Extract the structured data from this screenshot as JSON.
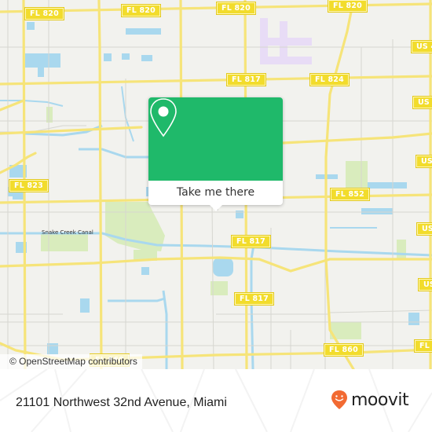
{
  "map": {
    "colors": {
      "background": "#f2f2ee",
      "road_major": "#f6e479",
      "road_minor": "#d6d6d0",
      "water": "#a9d8ee",
      "park": "#d9ecbd",
      "shield_fill": "#f2dc2c"
    },
    "road_shields": [
      {
        "id": "fl820-a",
        "label": "FL 820"
      },
      {
        "id": "fl820-b",
        "label": "FL 820"
      },
      {
        "id": "fl820-c",
        "label": "FL 820"
      },
      {
        "id": "fl820-d",
        "label": "FL 820"
      },
      {
        "id": "fl817-a",
        "label": "FL 817"
      },
      {
        "id": "fl824",
        "label": "FL 824"
      },
      {
        "id": "fl823",
        "label": "FL 823"
      },
      {
        "id": "fl852",
        "label": "FL 852"
      },
      {
        "id": "fl817-b",
        "label": "FL 817"
      },
      {
        "id": "fl817-c",
        "label": "FL 817"
      },
      {
        "id": "fl817-d",
        "label": "FL 817"
      },
      {
        "id": "fl860-a",
        "label": "FL 860"
      },
      {
        "id": "fl860-b",
        "label": "FL 860"
      },
      {
        "id": "fl860-c",
        "label": "FL"
      },
      {
        "id": "us-a",
        "label": "US 4"
      },
      {
        "id": "us-b",
        "label": "US"
      },
      {
        "id": "us-c",
        "label": "US"
      },
      {
        "id": "us-d",
        "label": "US"
      },
      {
        "id": "us-e",
        "label": "US"
      }
    ],
    "water_labels": [
      {
        "label": "Snake Creek Canal"
      }
    ],
    "attribution": "© OpenStreetMap contributors"
  },
  "popup": {
    "action_label": "Take me there",
    "icon": "map-pin-icon",
    "accent": "#1fb96a"
  },
  "footer": {
    "address": "21101 Northwest 32nd Avenue, Miami",
    "brand": {
      "name": "moovit",
      "icon": "moovit-logo-icon",
      "color": "#f26a32"
    }
  }
}
